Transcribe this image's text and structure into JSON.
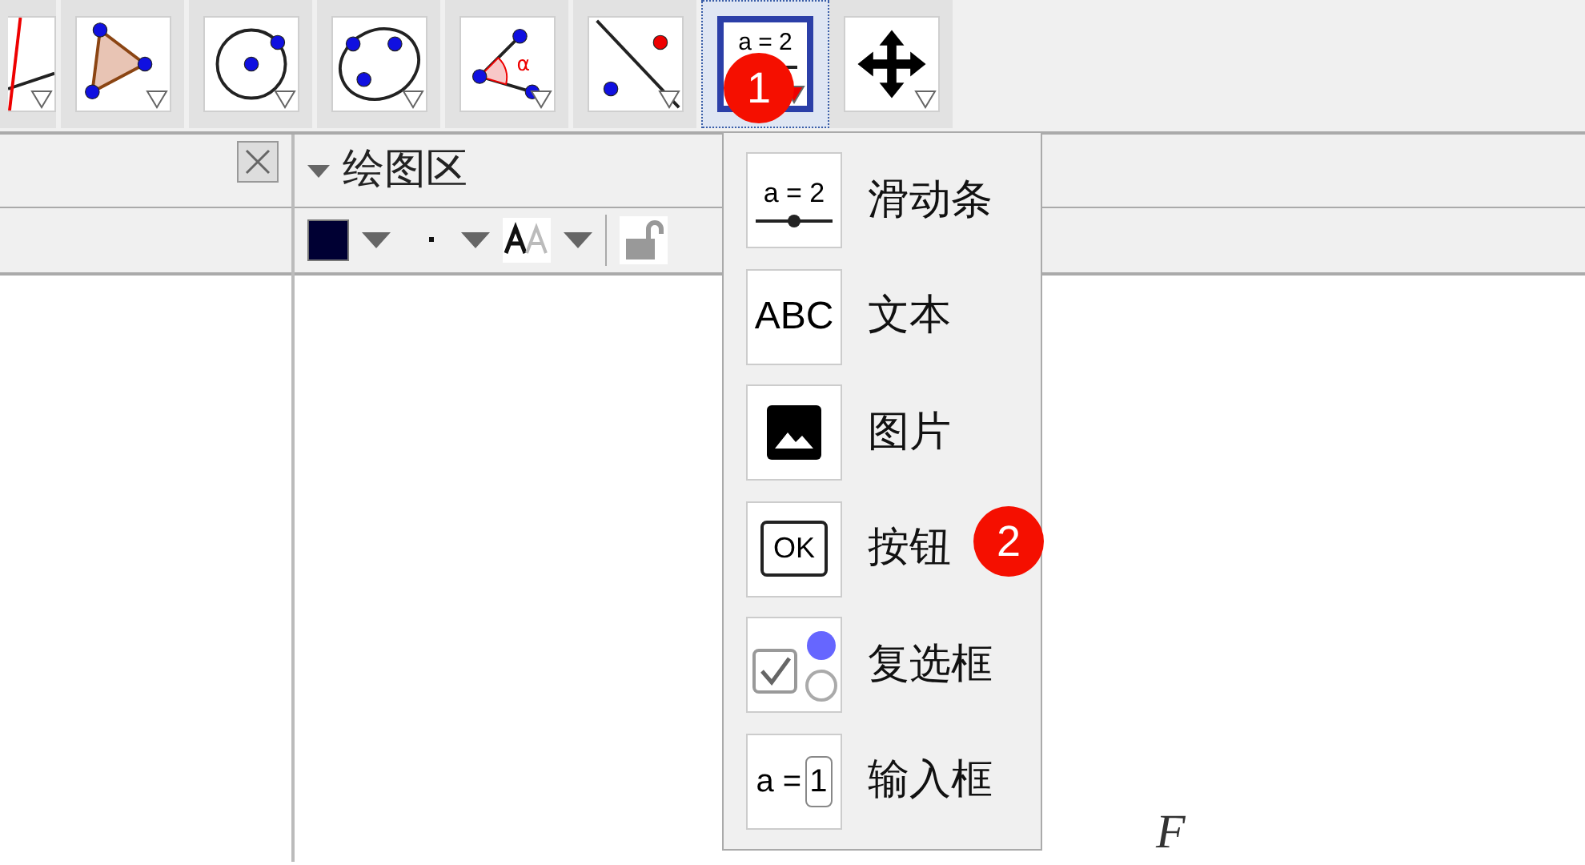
{
  "toolbar": {
    "tools": [
      {
        "kind": "line",
        "selected": false
      },
      {
        "kind": "polygon",
        "selected": false
      },
      {
        "kind": "circle",
        "selected": false
      },
      {
        "kind": "conic",
        "selected": false
      },
      {
        "kind": "angle",
        "selected": false,
        "icon_text": "α"
      },
      {
        "kind": "reflect",
        "selected": false
      },
      {
        "kind": "slider",
        "selected": true,
        "icon_text": "a = 2"
      },
      {
        "kind": "move",
        "selected": false
      }
    ]
  },
  "graphics_view": {
    "title": "绘图区",
    "style_bar": {
      "color": "#000033"
    },
    "point_labels": [
      "F"
    ]
  },
  "tool_menu": {
    "items": [
      {
        "kind": "slider",
        "icon_text": "a = 2",
        "label": "滑动条"
      },
      {
        "kind": "text",
        "icon_text": "ABC",
        "label": "文本"
      },
      {
        "kind": "image",
        "label": "图片"
      },
      {
        "kind": "button",
        "icon_text": "OK",
        "label": "按钮"
      },
      {
        "kind": "checkbox",
        "label": "复选框"
      },
      {
        "kind": "input",
        "icon_text": "a =",
        "icon_value": "1",
        "label": "输入框"
      }
    ]
  },
  "annotations": [
    "1",
    "2"
  ]
}
